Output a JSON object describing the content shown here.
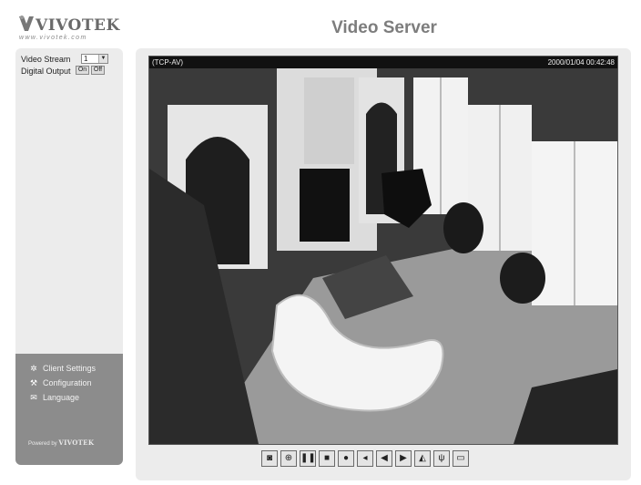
{
  "logo": {
    "brand": "VIVOTEK",
    "url": "www.vivotek.com"
  },
  "page_title": "Video Server",
  "controls": {
    "video_stream_label": "Video Stream",
    "video_stream_value": "1",
    "digital_output_label": "Digital Output",
    "on_label": "On",
    "off_label": "Off"
  },
  "menu": {
    "client_settings": "Client Settings",
    "configuration": "Configuration",
    "language": "Language",
    "powered_by": "Powered by",
    "powered_brand": "VIVOTEK"
  },
  "video": {
    "source_label": "(TCP-AV)",
    "timestamp": "2000/01/04 00:42:48"
  },
  "toolbar": {
    "tools": [
      "snapshot",
      "digital-zoom",
      "pause",
      "stop",
      "record",
      "volume-down",
      "volume-up",
      "talk",
      "mute",
      "microphone",
      "full-screen"
    ]
  },
  "colors": {
    "sidebar_bg": "#ececec",
    "menu_bg": "#8c8c8c",
    "title_gray": "#7d7d7d"
  }
}
